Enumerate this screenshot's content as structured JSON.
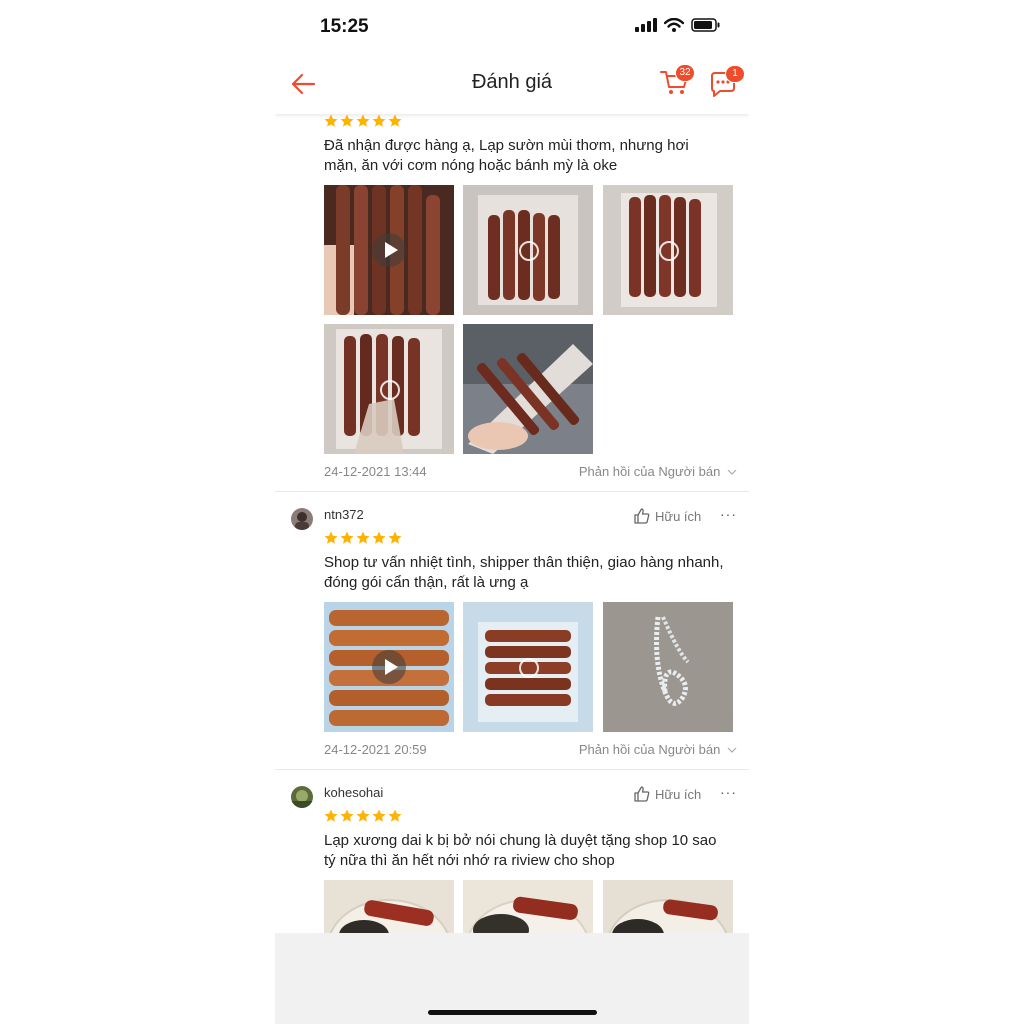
{
  "status_bar": {
    "time": "15:25"
  },
  "header": {
    "title": "Đánh giá",
    "cart_count": "32",
    "chat_count": "1"
  },
  "reviews": [
    {
      "stars": 5,
      "text": "Đã nhận được hàng ạ, Lạp sườn mùi thơm, nhưng hơi mặn, ăn với cơm nóng hoặc bánh mỳ là oke",
      "date": "24-12-2021 13:44",
      "reply_label": "Phản hồi của Người bán"
    },
    {
      "username": "ntn372",
      "helpful_label": "Hữu ích",
      "stars": 5,
      "text": "Shop tư vấn nhiệt tình, shipper thân thiện, giao hàng nhanh, đóng gói cẩn thận, rất là ưng ạ",
      "date": "24-12-2021 20:59",
      "reply_label": "Phản hồi của Người bán"
    },
    {
      "username": "kohesohai",
      "helpful_label": "Hữu ích",
      "stars": 5,
      "text": "Lạp xương dai k bị bở  nói chung là duyệt tặng shop  10 sao tý nữa thì ăn hết nới nhớ ra riview cho shop"
    }
  ],
  "colors": {
    "accent": "#ee4d2d",
    "star": "#ffb300"
  }
}
